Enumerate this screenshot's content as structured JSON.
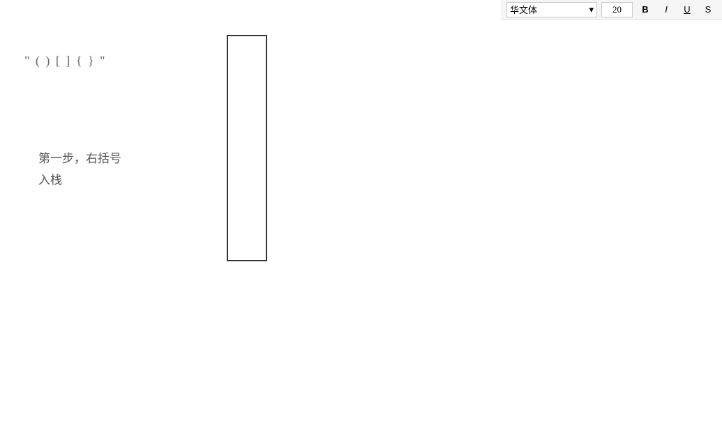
{
  "toolbar": {
    "font_label": "华文体",
    "size_label": "20",
    "bold_label": "B",
    "italic_label": "I",
    "underline_label": "U",
    "strikethrough_label": "S"
  },
  "content": {
    "line1": "\" ( ) [ ] { } \"",
    "block2_line1": "第一步，右括号",
    "block2_line2": "入栈"
  },
  "cursor": {
    "visible": true
  }
}
